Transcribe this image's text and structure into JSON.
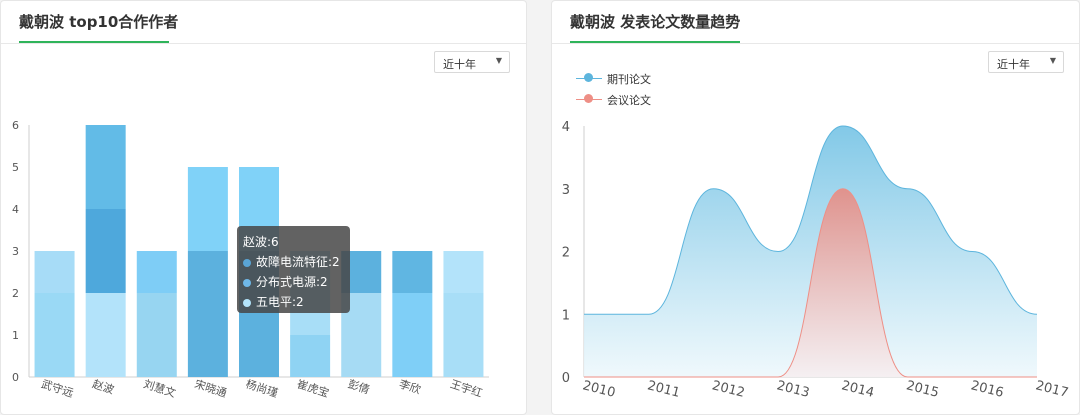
{
  "left": {
    "title": "戴朝波 top10合作作者",
    "select": "近十年",
    "tooltip": {
      "title": "赵波:6",
      "rows": [
        {
          "label": "故障电流特征:2",
          "color": "#5aa5d6"
        },
        {
          "label": "分布式电源:2",
          "color": "#6fb8e8"
        },
        {
          "label": "五电平:2",
          "color": "#b3e3fa"
        }
      ]
    }
  },
  "right": {
    "title": "戴朝波 发表论文数量趋势",
    "select": "近十年"
  },
  "chart_data": [
    {
      "type": "bar",
      "stacked": true,
      "categories": [
        "武守远",
        "赵波",
        "刘慧文",
        "宋晓通",
        "杨尚瑾",
        "崔虎宝",
        "彭倩",
        "李欣",
        "王宇红"
      ],
      "segments": [
        {
          "c": 0,
          "from": 0,
          "to": 2,
          "color": "#9ad9f5"
        },
        {
          "c": 0,
          "from": 2,
          "to": 3,
          "color": "#a7dcf7"
        },
        {
          "c": 1,
          "from": 0,
          "to": 2,
          "color": "#b3e3fa"
        },
        {
          "c": 1,
          "from": 2,
          "to": 4,
          "color": "#4ea8dc"
        },
        {
          "c": 1,
          "from": 4,
          "to": 6,
          "color": "#62bbe7"
        },
        {
          "c": 2,
          "from": 0,
          "to": 2,
          "color": "#97d5f1"
        },
        {
          "c": 2,
          "from": 2,
          "to": 3,
          "color": "#7ecdf6"
        },
        {
          "c": 3,
          "from": 0,
          "to": 3,
          "color": "#5cb1de"
        },
        {
          "c": 3,
          "from": 3,
          "to": 5,
          "color": "#80d2f8"
        },
        {
          "c": 4,
          "from": 0,
          "to": 3,
          "color": "#5cb1de"
        },
        {
          "c": 4,
          "from": 3,
          "to": 5,
          "color": "#80d2f8"
        },
        {
          "c": 5,
          "from": 0,
          "to": 1,
          "color": "#8fd3f3"
        },
        {
          "c": 5,
          "from": 1,
          "to": 3,
          "color": "#a8def7"
        },
        {
          "c": 6,
          "from": 0,
          "to": 2,
          "color": "#a6dbf4"
        },
        {
          "c": 6,
          "from": 2,
          "to": 3,
          "color": "#5cb1de"
        },
        {
          "c": 7,
          "from": 0,
          "to": 2,
          "color": "#7fcff7"
        },
        {
          "c": 7,
          "from": 2,
          "to": 3,
          "color": "#60b6e2"
        },
        {
          "c": 8,
          "from": 0,
          "to": 2,
          "color": "#a8def7"
        },
        {
          "c": 8,
          "from": 2,
          "to": 3,
          "color": "#b3e3fa"
        }
      ],
      "ylim": [
        0,
        6
      ],
      "yticks": [
        0,
        1,
        2,
        3,
        4,
        5,
        6
      ],
      "grid": false
    },
    {
      "type": "area",
      "x": [
        2010,
        2011,
        2012,
        2013,
        2014,
        2015,
        2016,
        2017
      ],
      "series": [
        {
          "name": "期刊论文",
          "values": [
            1,
            1,
            3,
            2,
            4,
            3,
            2,
            1
          ],
          "color": "#5db5dd"
        },
        {
          "name": "会议论文",
          "values": [
            0,
            0,
            0,
            0,
            3,
            0,
            0,
            0
          ],
          "color": "#ee8f86"
        }
      ],
      "ylim": [
        0,
        4
      ],
      "yticks": [
        0,
        1,
        2,
        3,
        4
      ],
      "legend": "top-left",
      "smooth": true
    }
  ]
}
